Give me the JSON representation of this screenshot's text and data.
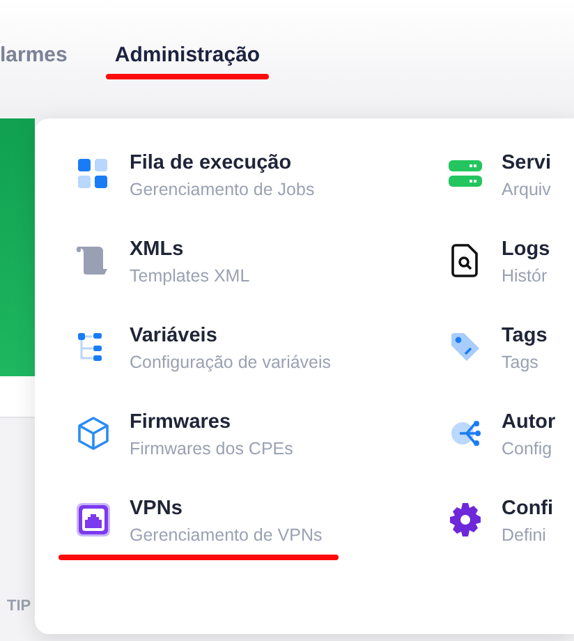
{
  "nav": {
    "tabs": [
      {
        "label": "larmes",
        "selected": false,
        "marked": false
      },
      {
        "label": "Administração",
        "selected": true,
        "marked": true
      }
    ]
  },
  "menu": {
    "columns": [
      {
        "items": [
          {
            "title": "Fila de execução",
            "subtitle": "Gerenciamento de Jobs",
            "marked": false
          },
          {
            "title": "XMLs",
            "subtitle": "Templates XML",
            "marked": false
          },
          {
            "title": "Variáveis",
            "subtitle": "Configuração de variáveis",
            "marked": false
          },
          {
            "title": "Firmwares",
            "subtitle": "Firmwares dos CPEs",
            "marked": false
          },
          {
            "title": "VPNs",
            "subtitle": "Gerenciamento de VPNs",
            "marked": true
          }
        ]
      },
      {
        "items": [
          {
            "title": "Servi",
            "subtitle": "Arquiv",
            "marked": false
          },
          {
            "title": "Logs",
            "subtitle": "Histór",
            "marked": false
          },
          {
            "title": "Tags",
            "subtitle": "Tags",
            "marked": false
          },
          {
            "title": "Autor",
            "subtitle": "Config",
            "marked": false
          },
          {
            "title": "Confi",
            "subtitle": "Defini",
            "marked": false
          }
        ]
      }
    ]
  },
  "background": {
    "column_label": "TIP"
  }
}
